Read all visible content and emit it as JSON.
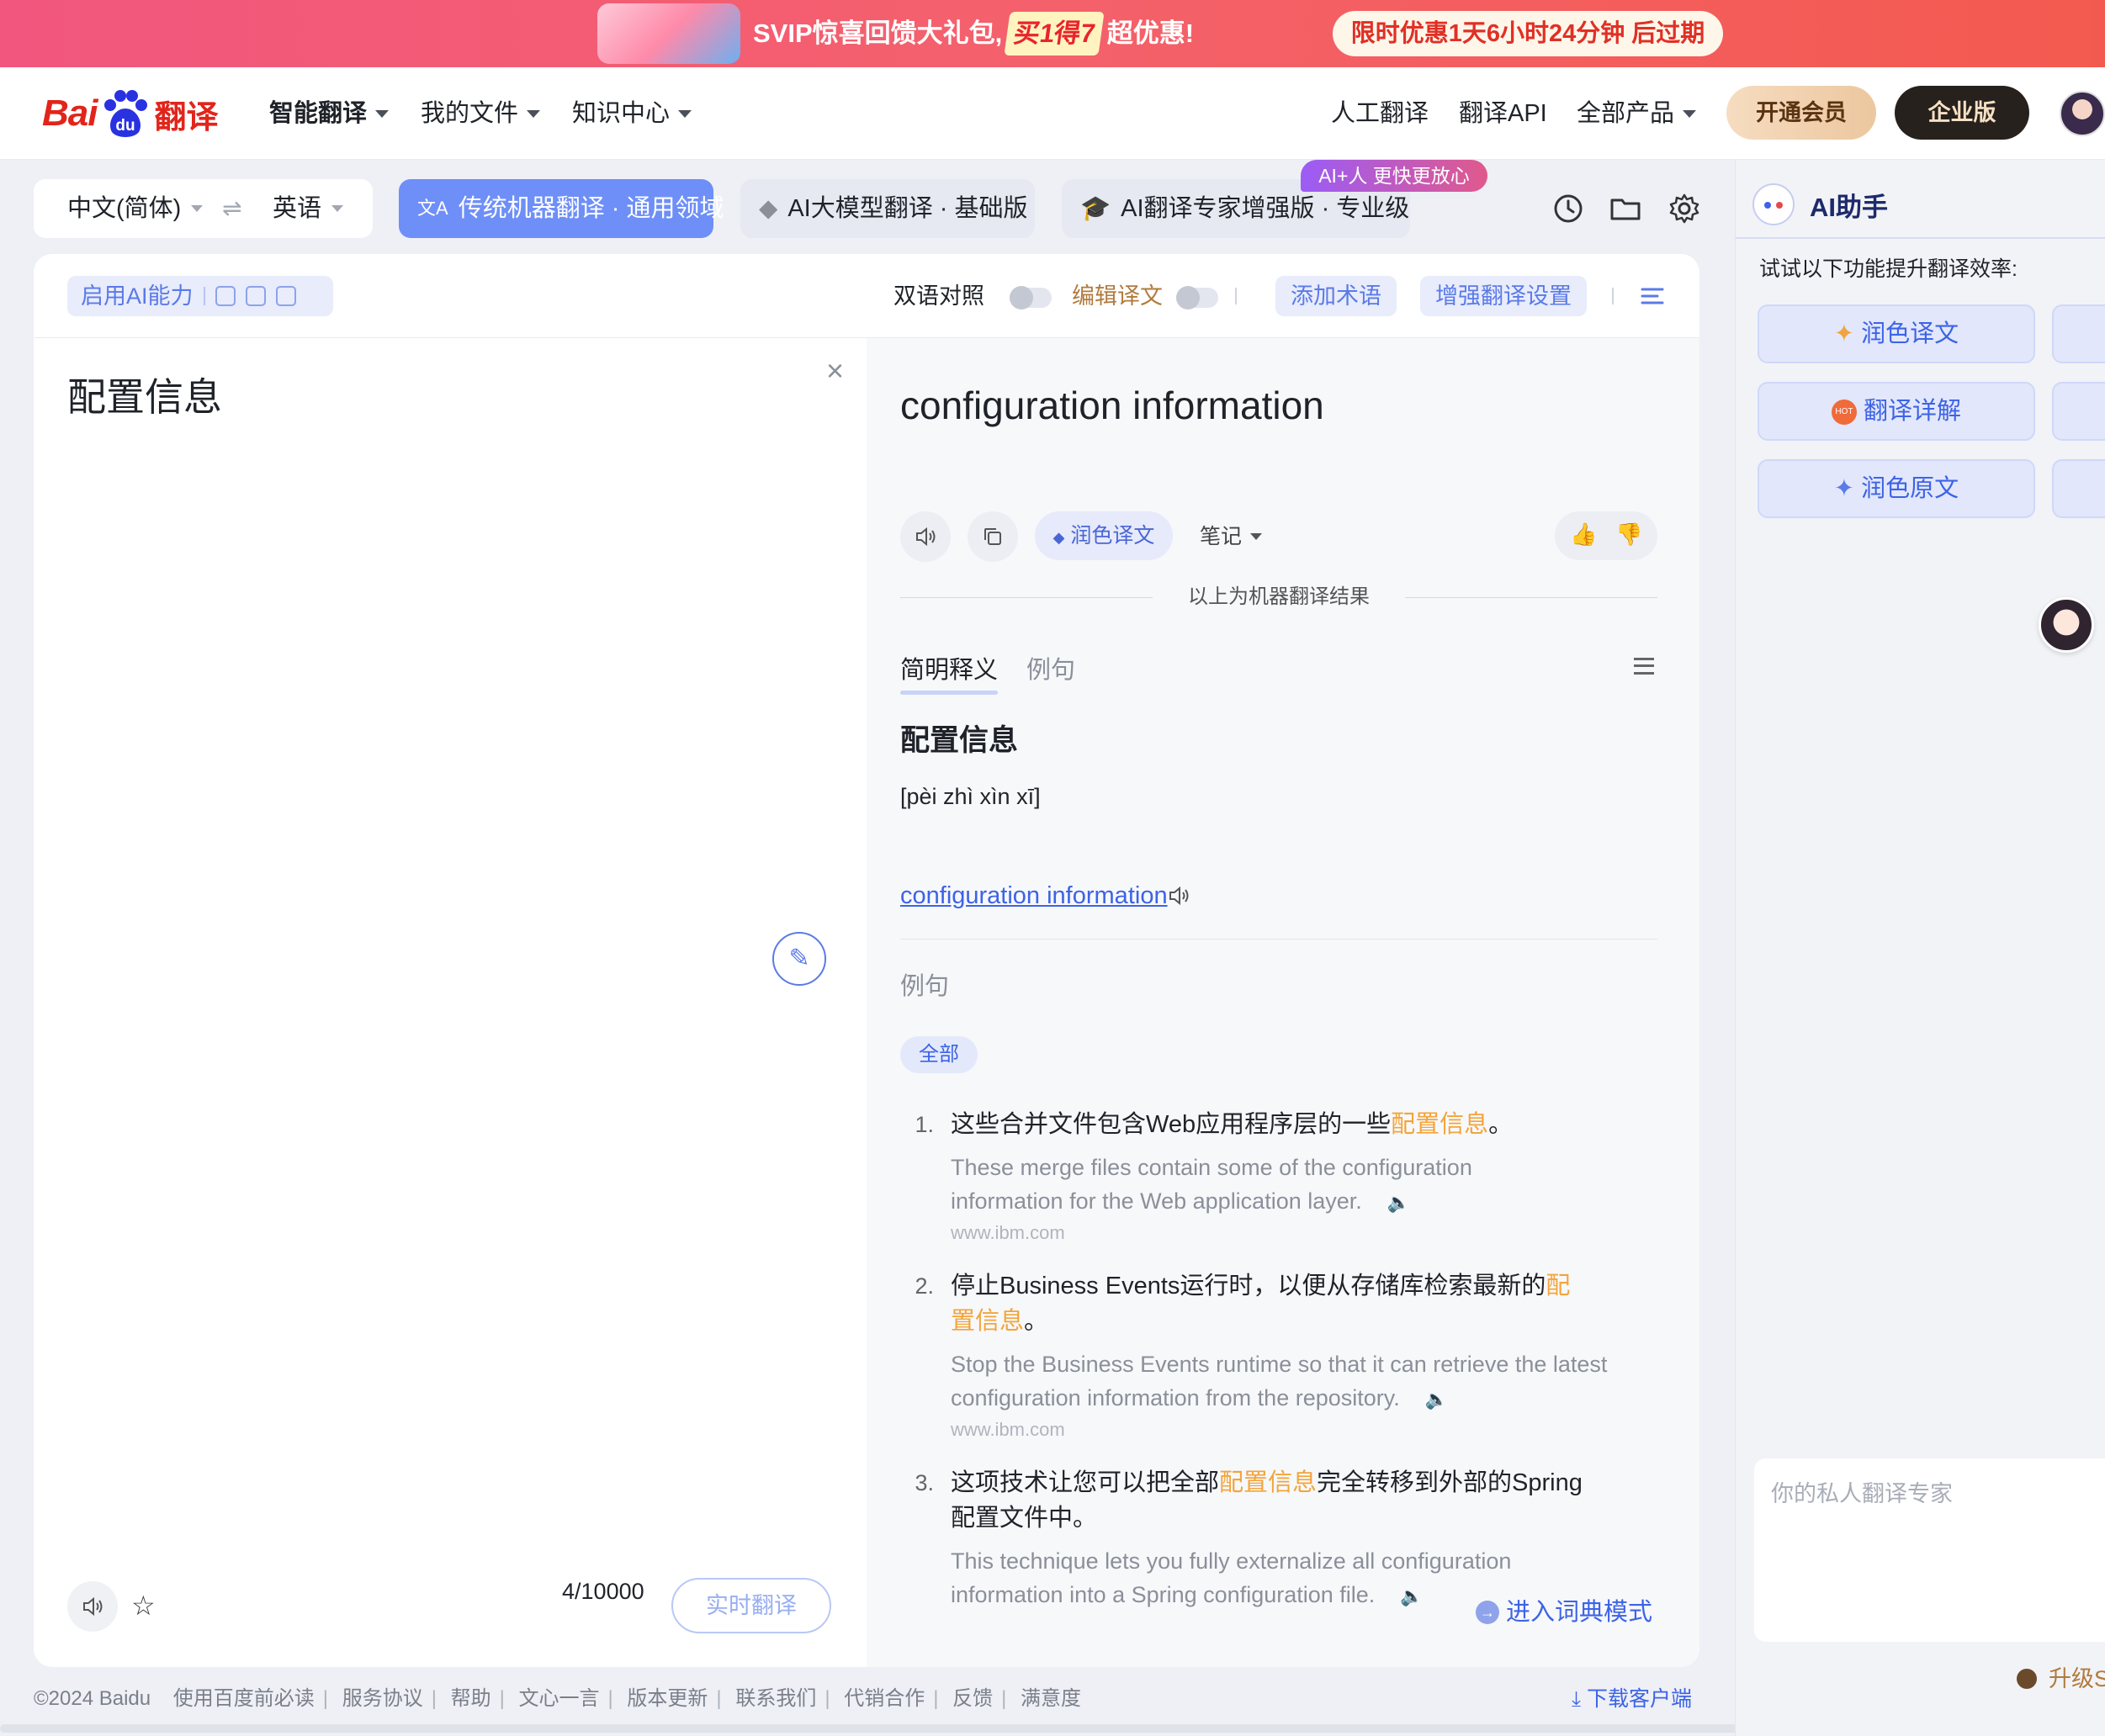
{
  "promo": {
    "text_before": "SVIP惊喜回馈大礼包,",
    "highlight": "买1得7",
    "text_after": "超优惠!",
    "countdown": "限时优惠1天6小时24分钟 后过期"
  },
  "nav": {
    "logo_bai": "Bai",
    "logo_du": "du",
    "logo_fy": "翻译",
    "items": [
      "智能翻译",
      "我的文件",
      "知识中心"
    ],
    "right_items": [
      "人工翻译",
      "翻译API",
      "全部产品"
    ],
    "vip": "开通会员",
    "enterprise": "企业版"
  },
  "toolbar": {
    "source_lang": "中文(简体)",
    "target_lang": "英语",
    "modes": [
      "传统机器翻译 · 通用领域",
      "AI大模型翻译 · 基础版",
      "AI翻译专家增强版 · 专业级"
    ],
    "ai_badge": "AI+人 更快更放心"
  },
  "card": {
    "ai_enable": "启用AI能力",
    "bilingual": "双语对照",
    "edit_translation": "编辑译文",
    "add_term": "添加术语",
    "enhance_settings": "增强翻译设置"
  },
  "source": {
    "text": "配置信息",
    "count": "4",
    "max": "/10000",
    "realtime": "实时翻译"
  },
  "target": {
    "text": "configuration information",
    "polish": "润色译文",
    "notes": "笔记",
    "machine_note": "以上为机器翻译结果"
  },
  "dict": {
    "tab_brief": "简明释义",
    "tab_examples": "例句",
    "word": "配置信息",
    "pinyin": "[pèi zhì xìn xī]",
    "definition": "configuration information",
    "examples_title": "例句",
    "chip_all": "全部",
    "examples": [
      {
        "num": "1.",
        "zh_before": "这些合并文件包含Web应用程序层的一些",
        "zh_hl": "配置信息",
        "zh_after": "。",
        "en": "These merge files contain some of the configuration information for the Web application layer.",
        "source": "www.ibm.com"
      },
      {
        "num": "2.",
        "zh_before": "停止Business Events运行时，以便从存储库检索最新的",
        "zh_hl": "配置信息",
        "zh_after": "。",
        "en": "Stop the Business Events runtime so that it can retrieve the latest configuration information from the repository.",
        "source": "www.ibm.com"
      },
      {
        "num": "3.",
        "zh_before": "这项技术让您可以把全部",
        "zh_hl": "配置信息",
        "zh_after": "完全转移到外部的Spring配置文件中。",
        "en": "This technique lets you fully externalize all configuration information into a Spring configuration file.",
        "source": ""
      }
    ],
    "dict_mode": "进入词典模式"
  },
  "footer": {
    "copyright": "©2024 Baidu",
    "links": [
      "使用百度前必读",
      "服务协议",
      "帮助",
      "文心一言",
      "版本更新",
      "联系我们",
      "代销合作",
      "反馈",
      "满意度"
    ],
    "download": "下载客户端"
  },
  "assistant": {
    "title": "AI助手",
    "tip": "试试以下功能提升翻译效率:",
    "buttons": [
      "润色译文",
      "翻译详解",
      "润色原文"
    ],
    "hot_badge": "HOT",
    "placeholder": "你的私人翻译专家",
    "upgrade": "升级S"
  }
}
